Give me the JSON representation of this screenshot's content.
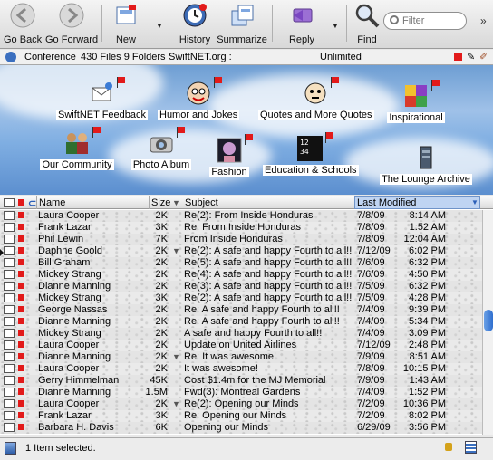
{
  "toolbar": {
    "go_back": "Go Back",
    "go_forward": "Go Forward",
    "new": "New",
    "history": "History",
    "summarize": "Summarize",
    "reply": "Reply",
    "find": "Find",
    "filter_placeholder": "Filter"
  },
  "status": {
    "conference": "Conference",
    "counts": "430 Files  9 Folders",
    "site": "SwiftNET.org :",
    "limit": "Unlimited"
  },
  "panel_items": [
    {
      "label": "SwiftNET Feedback",
      "icon": "feedback-icon"
    },
    {
      "label": "Humor and Jokes",
      "icon": "humor-icon"
    },
    {
      "label": "Quotes and More Quotes",
      "icon": "quotes-icon"
    },
    {
      "label": "Inspirational",
      "icon": "inspirational-icon"
    },
    {
      "label": "Our Community",
      "icon": "community-icon"
    },
    {
      "label": "Photo Album",
      "icon": "photo-album-icon"
    },
    {
      "label": "Fashion",
      "icon": "fashion-icon"
    },
    {
      "label": "Education & Schools",
      "icon": "education-icon"
    },
    {
      "label": "The Lounge Archive",
      "icon": "lounge-archive-icon"
    }
  ],
  "table": {
    "headers": {
      "name": "Name",
      "size": "Size",
      "subject": "Subject",
      "modified": "Last Modified"
    },
    "rows": [
      {
        "name": "Laura Cooper",
        "size": "2K",
        "tri": "",
        "subject": "   Re(2): From Inside Honduras",
        "date": "7/8/09",
        "time": "8:14 AM"
      },
      {
        "name": "Frank Lazar",
        "size": "3K",
        "tri": "",
        "subject": "   Re: From Inside Honduras",
        "date": "7/8/09",
        "time": "1:52 AM"
      },
      {
        "name": "Phil Lewin",
        "size": "7K",
        "tri": "",
        "subject": "   From Inside Honduras",
        "date": "7/8/09",
        "time": "12:04 AM"
      },
      {
        "name": "Daphne Goold",
        "size": "2K",
        "tri": "▼",
        "subject": "Re(2): A safe and happy Fourth to all!!",
        "date": "7/12/09",
        "time": "6:02 PM"
      },
      {
        "name": "Bill Graham",
        "size": "2K",
        "tri": "",
        "subject": "   Re(5): A safe and happy Fourth to all!!",
        "date": "7/6/09",
        "time": "6:32 PM"
      },
      {
        "name": "Mickey Strang",
        "size": "2K",
        "tri": "",
        "subject": "   Re(4): A safe and happy Fourth to all!!",
        "date": "7/6/09",
        "time": "4:50 PM"
      },
      {
        "name": "Dianne Manning",
        "size": "2K",
        "tri": "",
        "subject": "   Re(3): A safe and happy Fourth to all!!",
        "date": "7/5/09",
        "time": "6:32 PM"
      },
      {
        "name": "Mickey Strang",
        "size": "3K",
        "tri": "",
        "subject": "   Re(2): A safe and happy Fourth to all!!",
        "date": "7/5/09",
        "time": "4:28 PM"
      },
      {
        "name": "George Nassas",
        "size": "2K",
        "tri": "",
        "subject": "   Re: A safe and happy Fourth to all!!",
        "date": "7/4/09",
        "time": "9:39 PM"
      },
      {
        "name": "Dianne Manning",
        "size": "2K",
        "tri": "",
        "subject": "   Re: A safe and happy Fourth to all!!",
        "date": "7/4/09",
        "time": "5:34 PM"
      },
      {
        "name": "Mickey Strang",
        "size": "2K",
        "tri": "",
        "subject": "   A safe and happy Fourth to all!!",
        "date": "7/4/09",
        "time": "3:09 PM"
      },
      {
        "name": "Laura Cooper",
        "size": "2K",
        "tri": "",
        "subject": "Update on United Airlines",
        "date": "7/12/09",
        "time": "2:48 PM"
      },
      {
        "name": "Dianne Manning",
        "size": "2K",
        "tri": "▼",
        "subject": "Re: It was awesome!",
        "date": "7/9/09",
        "time": "8:51 AM"
      },
      {
        "name": "Laura Cooper",
        "size": "2K",
        "tri": "",
        "subject": "   It was awesome!",
        "date": "7/8/09",
        "time": "10:15 PM"
      },
      {
        "name": "Gerry Himmelman",
        "size": "45K",
        "tri": "",
        "subject": "Cost $1.4m for the MJ Memorial",
        "date": "7/9/09",
        "time": "1:43 AM"
      },
      {
        "name": "Dianne Manning",
        "size": "1.5M",
        "tri": "",
        "subject": "Fwd(3): Montreal Gardens",
        "date": "7/4/09",
        "time": "1:52 PM"
      },
      {
        "name": "Laura Cooper",
        "size": "2K",
        "tri": "▼",
        "subject": "Re(2): Opening our Minds",
        "date": "7/2/09",
        "time": "10:36 PM"
      },
      {
        "name": "Frank Lazar",
        "size": "3K",
        "tri": "",
        "subject": "   Re: Opening our Minds",
        "date": "7/2/09",
        "time": "8:02 PM"
      },
      {
        "name": "Barbara H. Davis",
        "size": "6K",
        "tri": "",
        "subject": "   Opening our Minds",
        "date": "6/29/09",
        "time": "3:56 PM"
      }
    ]
  },
  "bottom": {
    "status": "1 Item selected."
  }
}
